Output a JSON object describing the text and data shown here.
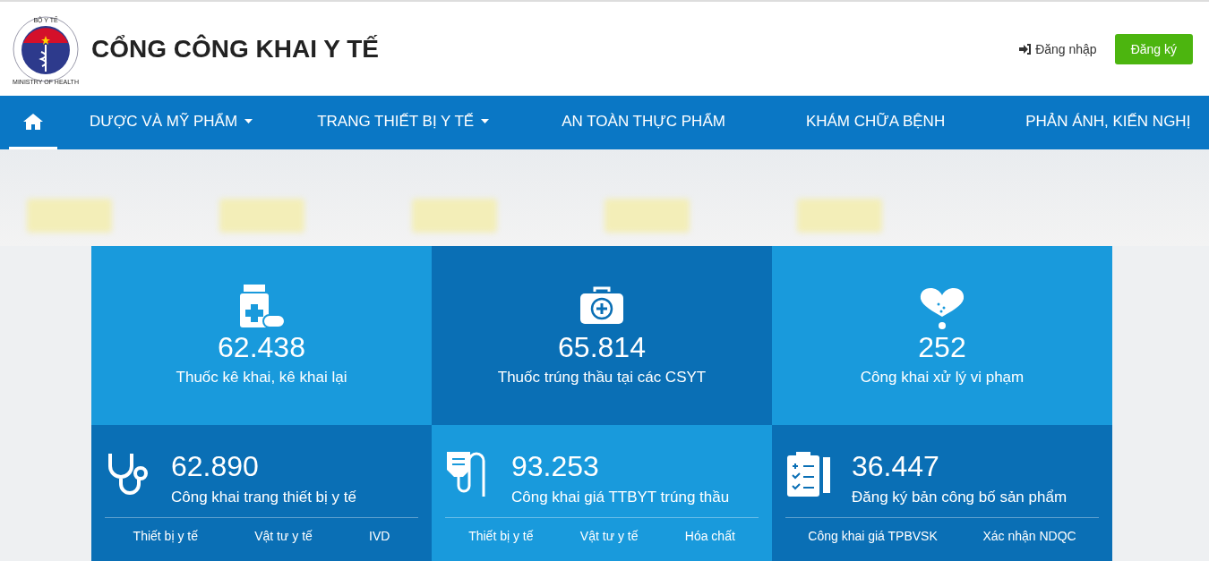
{
  "header": {
    "logo_text_top": "BỘ Y TẾ",
    "logo_text_bottom": "MINISTRY OF HEALTH",
    "title": "CỔNG CÔNG KHAI Y TẾ",
    "login": "Đăng nhập",
    "register": "Đăng ký"
  },
  "nav": [
    {
      "kind": "home",
      "selected": true
    },
    {
      "kind": "text",
      "label": "DƯỢC VÀ MỸ PHẨM",
      "dropdown": true,
      "selected": false
    },
    {
      "kind": "text",
      "label": "TRANG THIẾT BỊ Y TẾ",
      "dropdown": true,
      "selected": false
    },
    {
      "kind": "text",
      "label": "AN TOÀN THỰC PHẨM",
      "dropdown": false,
      "selected": false
    },
    {
      "kind": "text",
      "label": "KHÁM CHỮA BỆNH",
      "dropdown": false,
      "selected": false
    },
    {
      "kind": "text",
      "label": "PHẢN ÁNH, KIẾN NGHỊ",
      "dropdown": false,
      "selected": false
    }
  ],
  "tiles_top": [
    {
      "value": "62.438",
      "label": "Thuốc kê khai, kê khai lại",
      "dark": false
    },
    {
      "value": "65.814",
      "label": "Thuốc trúng thầu tại các CSYT",
      "dark": true
    },
    {
      "value": "252",
      "label": "Công khai xử lý vi phạm",
      "dark": false
    }
  ],
  "tiles_bottom": [
    {
      "value": "62.890",
      "label": "Công khai trang thiết bị y tế",
      "dark": true,
      "links": [
        "Thiết bị y tế",
        "Vật tư y tế",
        "IVD"
      ]
    },
    {
      "value": "93.253",
      "label": "Công khai giá TTBYT trúng thầu",
      "dark": false,
      "links": [
        "Thiết bị y tế",
        "Vật tư y tế",
        "Hóa chất"
      ]
    },
    {
      "value": "36.447",
      "label": "Đăng ký bản công bố sản phẩm",
      "dark": true,
      "links": [
        "Công khai giá TPBVSK",
        "Xác nhận NDQC"
      ]
    }
  ]
}
